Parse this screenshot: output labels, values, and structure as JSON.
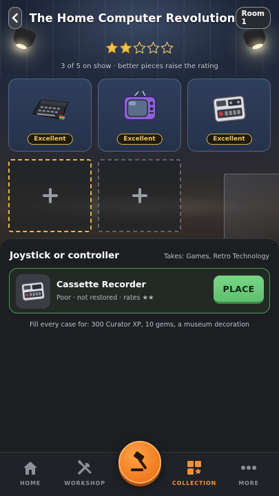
{
  "header": {
    "title": "The Home Computer Revolution",
    "room_badge": "Room 1"
  },
  "rating": {
    "stars_filled": 2,
    "stars_total": 5,
    "caption": "3 of 5 on show · better pieces raise the rating"
  },
  "cases": [
    {
      "item_icon": "home-computer-icon",
      "grade": "Excellent"
    },
    {
      "item_icon": "purple-television-icon",
      "grade": "Excellent"
    },
    {
      "item_icon": "cassette-recorder-icon",
      "grade": "Excellent"
    }
  ],
  "empty_slots": [
    {
      "state": "selected",
      "icon": "plus-icon"
    },
    {
      "state": "empty",
      "icon": "plus-icon"
    }
  ],
  "sheet": {
    "slot_name": "Joystick or controller",
    "takes": "Takes: Games, Retro Technology",
    "item": {
      "name": "Cassette Recorder",
      "meta": "Poor · not restored · rates ★★",
      "icon": "cassette-recorder-icon",
      "place_label": "PLACE"
    },
    "reward_line": "Fill every case for: 300 Curator XP, 10 gems, a museum decoration"
  },
  "nav": {
    "items": [
      {
        "label": "HOME",
        "icon": "house-icon",
        "active": false
      },
      {
        "label": "WORKSHOP",
        "icon": "tools-icon",
        "active": false
      },
      {
        "label": "COLLECTION",
        "icon": "collection-grid-icon",
        "active": true
      },
      {
        "label": "MORE",
        "icon": "more-dots-icon",
        "active": false
      }
    ],
    "center_icon": "auction-gavel-icon"
  },
  "colors": {
    "accent_orange": "#f0923a",
    "grade_gold": "#e2b24a",
    "place_green": "#6fcf7e",
    "case_blue": "#2c3a56"
  }
}
